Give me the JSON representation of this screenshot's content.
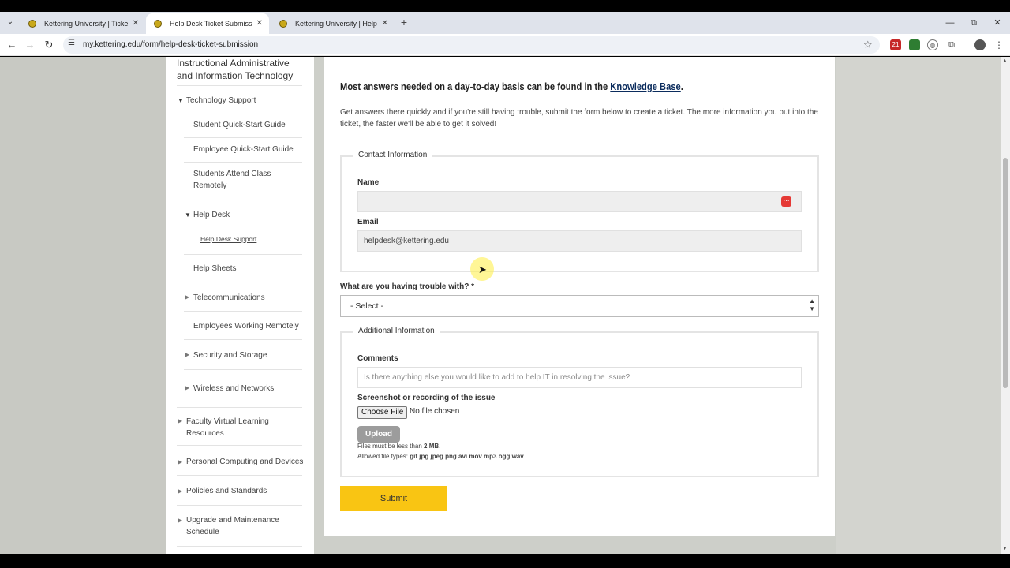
{
  "browser": {
    "tabs": [
      {
        "title": "Kettering University | Ticket",
        "active": false
      },
      {
        "title": "Help Desk Ticket Submission | K",
        "active": true
      },
      {
        "title": "Kettering University | Help Shee",
        "active": false
      }
    ],
    "new_tab": "+",
    "url": "my.kettering.edu/form/help-desk-ticket-submission",
    "window_controls": {
      "minimize": "—",
      "restore": "⧉",
      "close": "✕"
    },
    "extension_badge": "21"
  },
  "sidebar": {
    "section_title": "Instructional Administrative and Information Technology",
    "group": "Technology Support",
    "items": [
      {
        "label": "Student Quick-Start Guide"
      },
      {
        "label": "Employee Quick-Start Guide"
      },
      {
        "label": "Students Attend Class Remotely"
      },
      {
        "label": "Help Desk"
      },
      {
        "label": "Help Desk Support"
      },
      {
        "label": "Help Sheets"
      },
      {
        "label": "Telecommunications"
      },
      {
        "label": "Employees Working Remotely"
      },
      {
        "label": "Security and Storage"
      },
      {
        "label": "Wireless and Networks"
      }
    ],
    "top_items": [
      {
        "label": "Faculty Virtual Learning Resources"
      },
      {
        "label": "Personal Computing and Devices"
      },
      {
        "label": "Policies and Standards"
      },
      {
        "label": "Upgrade and Maintenance Schedule"
      }
    ]
  },
  "form": {
    "heading_prefix": "Most answers needed on a day-to-day basis can be found in the",
    "heading_link": "Knowledge Base",
    "heading_suffix": ".",
    "intro": "Get answers there quickly and if you're still having trouble, submit the form below to create a ticket. The more information you put into the ticket, the faster we'll be able to get it solved!",
    "contact": {
      "legend": "Contact Information",
      "name_label": "Name",
      "name_value": "",
      "email_label": "Email",
      "email_value": "helpdesk@kettering.edu"
    },
    "trouble": {
      "label": "What are you having trouble with? *",
      "selected": "- Select -"
    },
    "additional": {
      "legend": "Additional Information",
      "comments_label": "Comments",
      "comments_placeholder": "Is there anything else you would like to add to help IT in resolving the issue?",
      "screenshot_label": "Screenshot or recording of the issue",
      "choose_file": "Choose File",
      "no_file": "No file chosen",
      "upload": "Upload",
      "size_note_prefix": "Files must be less than",
      "size_note_value": "2 MB",
      "types_note_prefix": "Allowed file types:",
      "types_note_value": "gif jpg jpeg png avi mov mp3 ogg wav"
    },
    "submit": "Submit"
  }
}
